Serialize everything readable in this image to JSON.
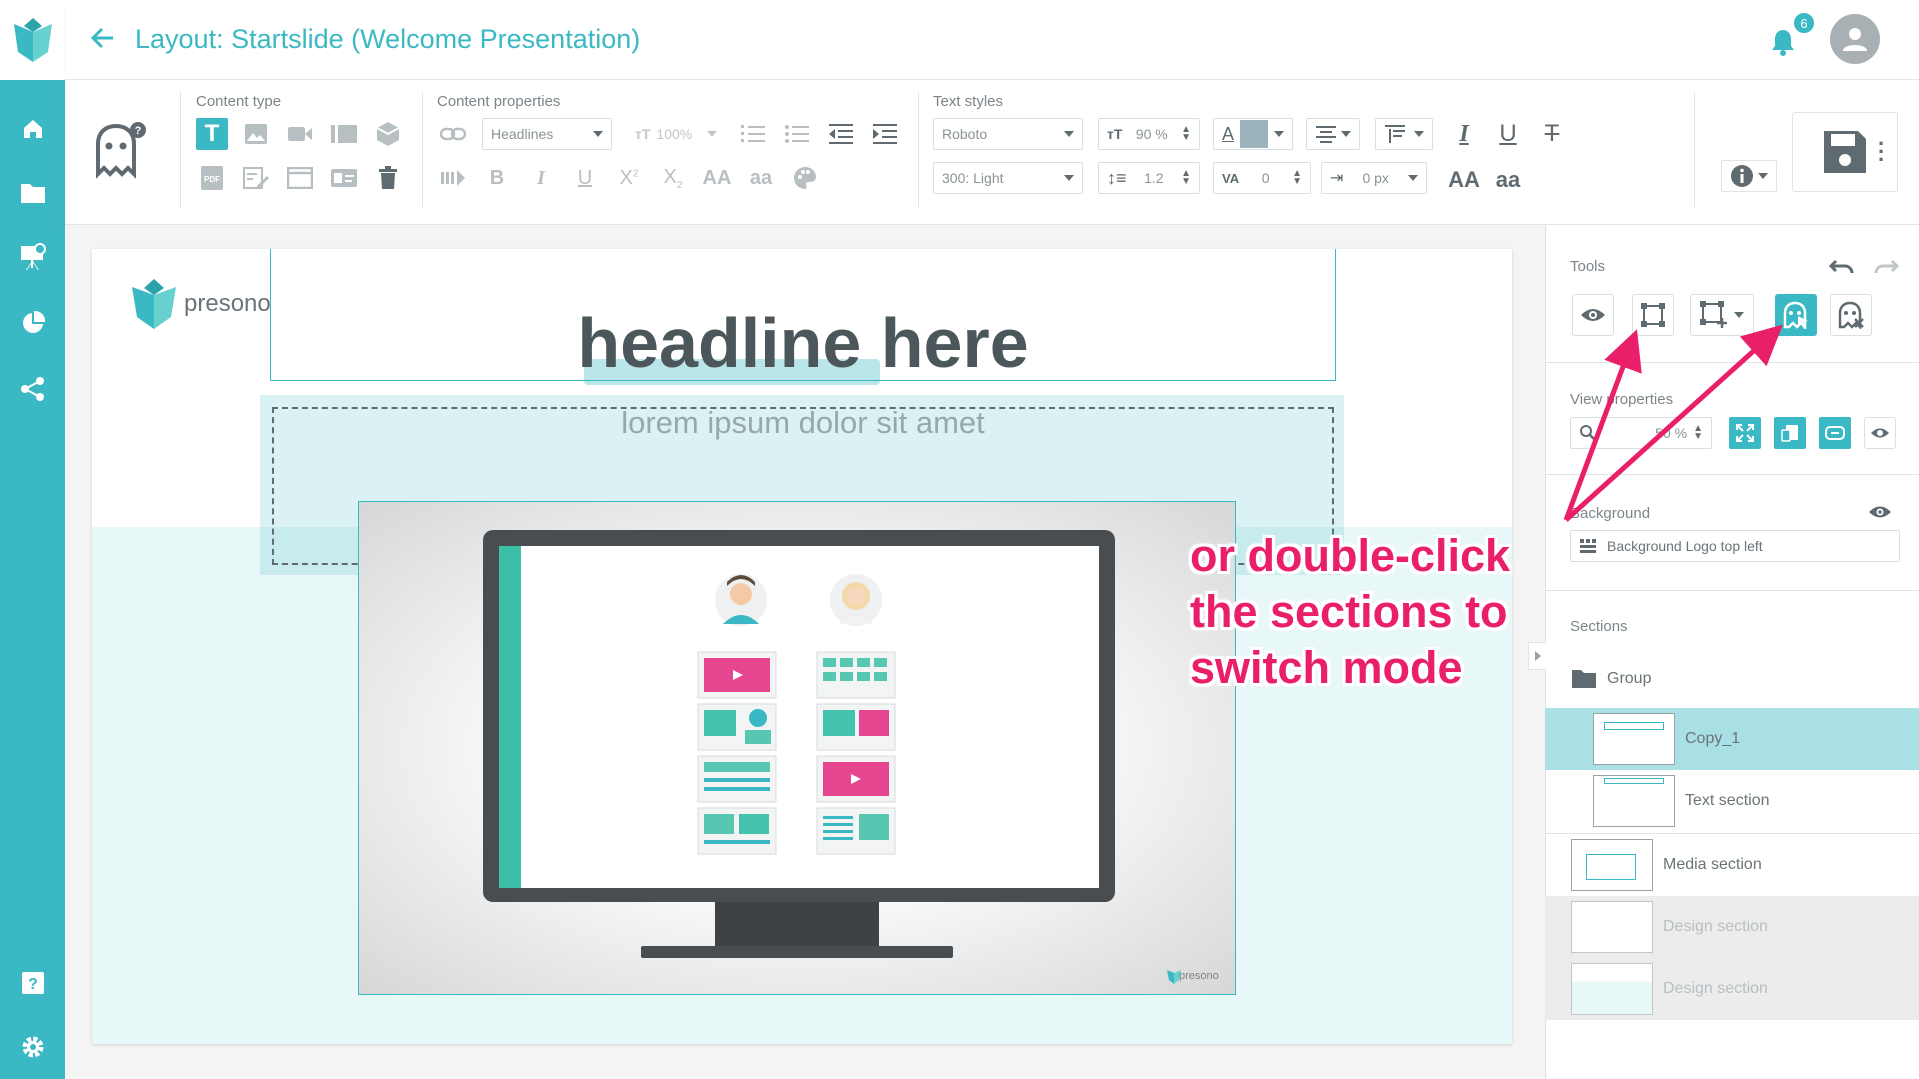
{
  "app": {
    "title": "Layout: Startslide (Welcome Presentation)",
    "notification_count": "6"
  },
  "sidebar": {
    "items": [
      {
        "icon": "home-icon"
      },
      {
        "icon": "folder-icon"
      },
      {
        "icon": "presentation-icon"
      },
      {
        "icon": "pie-chart-icon"
      },
      {
        "icon": "share-icon"
      },
      {
        "icon": "help-icon"
      },
      {
        "icon": "settings-icon"
      }
    ]
  },
  "toolbar": {
    "content_type_label": "Content type",
    "content_properties_label": "Content properties",
    "text_styles_label": "Text styles",
    "content_font_select": "Headlines",
    "content_size": "100%",
    "font_family": "Roboto",
    "font_weight": "300: Light",
    "font_size": "90 %",
    "line_height": "1.2",
    "letter_spacing": "0",
    "indent": "0 px",
    "text_color": "#9bb3bb",
    "accent": "#3ab8c3"
  },
  "slide": {
    "logo_text": "presono",
    "headline": "headline here",
    "subtitle": "lorem ipsum dolor sit amet",
    "media_logo_text": "presono"
  },
  "panel": {
    "tools_label": "Tools",
    "view_properties_label": "View properties",
    "zoom_value": "50 %",
    "background_label": "Background",
    "background_value": "Background Logo top left",
    "sections_label": "Sections",
    "sections": [
      {
        "name": "Group",
        "type": "folder"
      },
      {
        "name": "Copy_1",
        "selected": true
      },
      {
        "name": "Text section"
      },
      {
        "name": "Media section"
      },
      {
        "name": "Design section",
        "dimmed": true
      },
      {
        "name": "Design section",
        "dimmed": true
      }
    ]
  },
  "callout": {
    "line1": "or double-click",
    "line2": "the sections to",
    "line3": "switch mode"
  }
}
